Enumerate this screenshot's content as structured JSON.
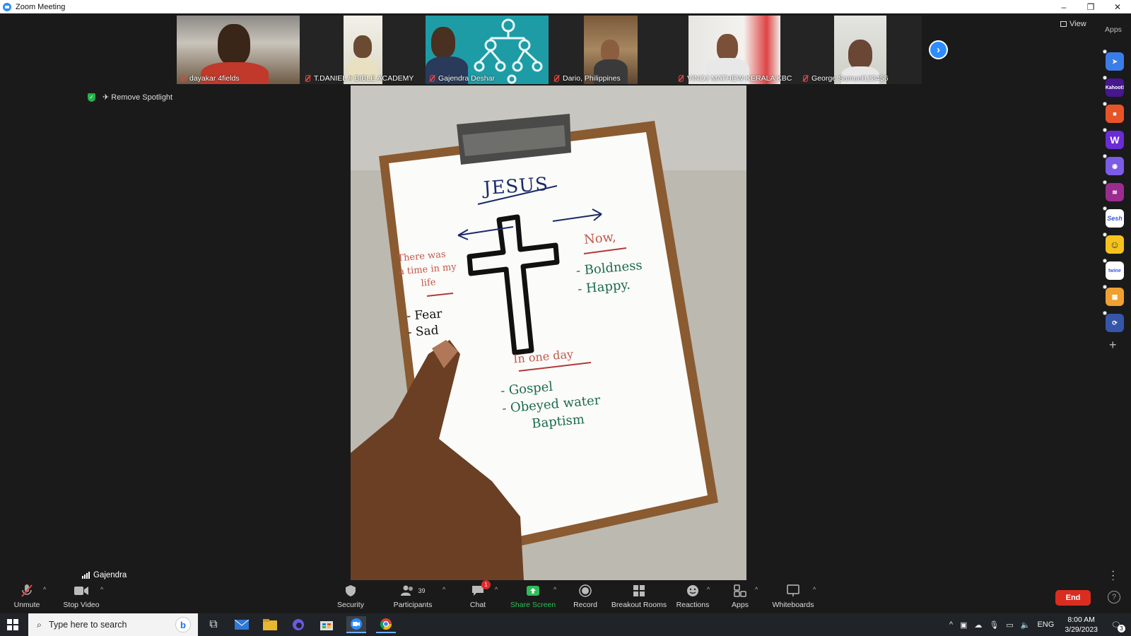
{
  "window": {
    "title": "Zoom Meeting",
    "controls": [
      "–",
      "❐",
      "✕"
    ]
  },
  "gallery": {
    "participants": [
      {
        "name": "dayakar 4fields",
        "muted": true
      },
      {
        "name": "T.DANIEL # BIBLE ACADEMY",
        "muted": true
      },
      {
        "name": "Gajendra Deshar",
        "muted": true
      },
      {
        "name": "Dario, Philippines",
        "muted": true
      },
      {
        "name": "VINOJ MATHEW-KERALA KBC",
        "muted": true
      },
      {
        "name": "George Samuel123456",
        "muted": true
      }
    ],
    "next_icon": "chevron-right-icon"
  },
  "top_right": {
    "view_label": "View",
    "apps_label": "Apps"
  },
  "spotlight": {
    "remove_label": "Remove Spotlight"
  },
  "speaker": {
    "name": "Gajendra"
  },
  "whiteboard": {
    "title": "JESUS",
    "left_heading": [
      "There was",
      "a time in my",
      "life"
    ],
    "left_items": [
      "- Fear",
      "- Sad"
    ],
    "right_heading": "Now,",
    "right_items": [
      "- Boldness",
      "- Happy."
    ],
    "bottom_heading": "In one day",
    "bottom_items": [
      "- Gospel",
      "- Obeyed water",
      "Baptism"
    ]
  },
  "side_apps": [
    {
      "icon": "arrow-app-icon",
      "label": "",
      "color": "#3b7de8"
    },
    {
      "icon": "kahoot-icon",
      "label": "Kahoot!",
      "color": "#46178f"
    },
    {
      "icon": "orange-app-icon",
      "label": "",
      "color": "#e8542a"
    },
    {
      "icon": "wordwall-icon",
      "label": "W",
      "color": "#6a2cd6"
    },
    {
      "icon": "camera-app-icon",
      "label": "",
      "color": "#7c5be6"
    },
    {
      "icon": "wave-app-icon",
      "label": "",
      "color": "#9b2c8f"
    },
    {
      "icon": "sesh-icon",
      "label": "Sesh",
      "color": "#ffffff"
    },
    {
      "icon": "smiley-app-icon",
      "label": "",
      "color": "#f5c31c"
    },
    {
      "icon": "twine-icon",
      "label": "twine",
      "color": "#ffffff"
    },
    {
      "icon": "grid-app-icon",
      "label": "",
      "color": "#f0a030"
    },
    {
      "icon": "sync-app-icon",
      "label": "",
      "color": "#3556a8"
    }
  ],
  "toolbar": {
    "unmute": "Unmute",
    "stop_video": "Stop Video",
    "security": "Security",
    "participants": "Participants",
    "participants_count": "39",
    "chat": "Chat",
    "chat_badge": "1",
    "share_screen": "Share Screen",
    "record": "Record",
    "breakout_rooms": "Breakout Rooms",
    "reactions": "Reactions",
    "apps": "Apps",
    "whiteboards": "Whiteboards",
    "end": "End",
    "help": "?"
  },
  "taskbar": {
    "search_placeholder": "Type here to search",
    "language": "ENG",
    "time": "8:00 AM",
    "date": "3/29/2023",
    "notification_count": "3"
  },
  "colors": {
    "accent": "#2d8cff",
    "end": "#d92d20",
    "share_green": "#2ebd5a"
  }
}
